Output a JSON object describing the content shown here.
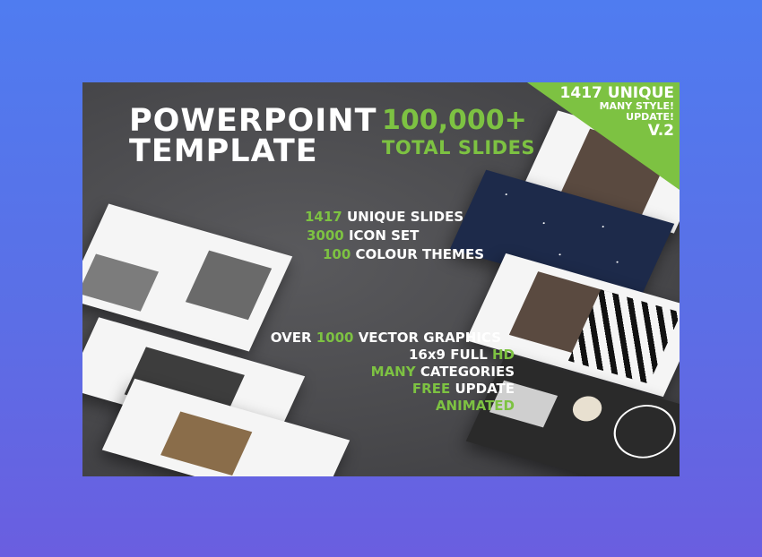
{
  "banner": {
    "title_line1": "POWERPOINT",
    "title_line2": "TEMPLATE",
    "total_number": "100,000+",
    "total_label": "TOTAL SLIDES",
    "corner": {
      "line1": "1417 UNIQUE",
      "line2": "MANY STYLE!",
      "line3": "UPDATE!",
      "line4": "V.2"
    },
    "features_top": [
      {
        "num": "1417",
        "rest": " UNIQUE SLIDES"
      },
      {
        "num": "3000",
        "rest": " ICON SET"
      },
      {
        "num": "100",
        "rest": " COLOUR THEMES"
      }
    ],
    "features_bottom": {
      "l1_a": "OVER ",
      "l1_b": "1000",
      "l1_c": " VECTOR GRAPHICS",
      "l2_a": "16x9 FULL ",
      "l2_b": "HD",
      "l3_a": "MANY",
      "l3_b": " CATEGORIES",
      "l4_a": "FREE",
      "l4_b": " UPDATE",
      "l5": "ANIMATED"
    },
    "accent_color": "#7dc242",
    "background_color": "#4a4a4d"
  },
  "page": {
    "background_gradient_top": "#4f7cf0",
    "background_gradient_bottom": "#6a5ee0"
  }
}
